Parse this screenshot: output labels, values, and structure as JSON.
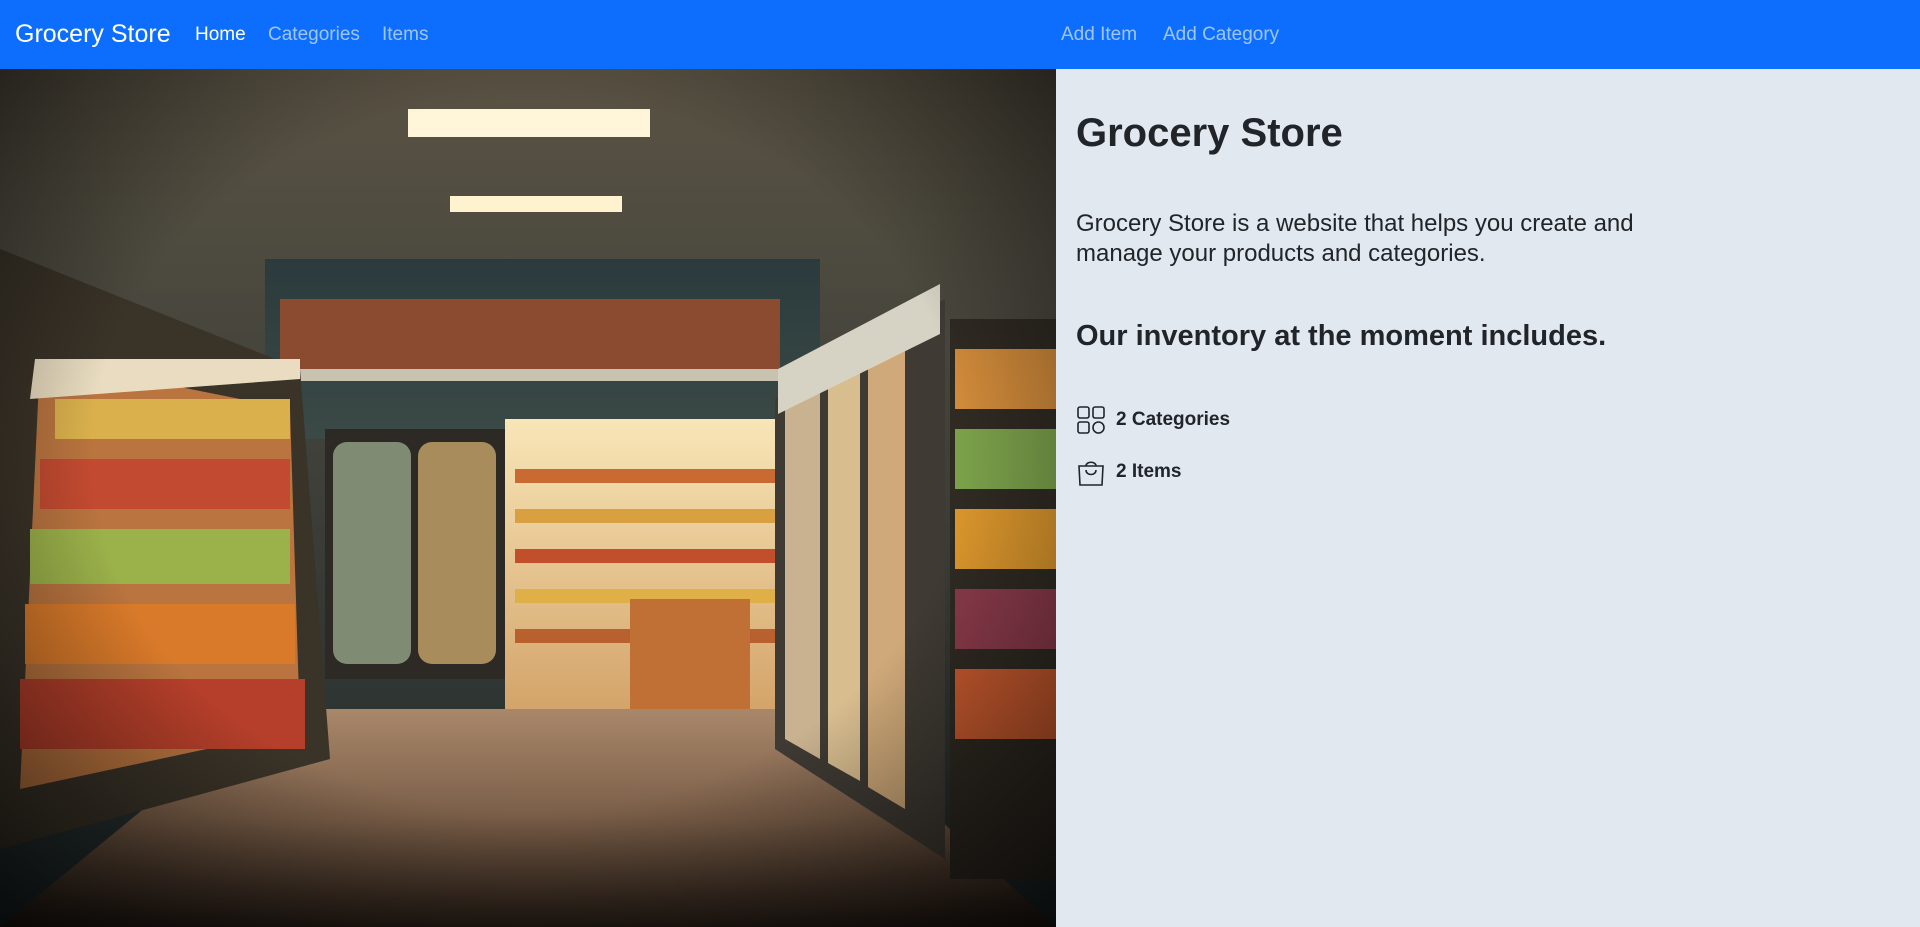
{
  "navbar": {
    "brand": "Grocery Store",
    "links": [
      "Home",
      "Categories",
      "Items"
    ],
    "right_links": [
      "Add Item",
      "Add Category"
    ],
    "active": "Home",
    "color": "#0d6efd"
  },
  "hero": {
    "icon": "grocery-store-aisle-image"
  },
  "main": {
    "title": "Grocery Store",
    "description": "Grocery Store is a website that helps you create and manage your products and categories.",
    "inventory_heading": "Our inventory at the moment includes.",
    "stats": [
      {
        "icon": "grid-icon",
        "label": "2 Categories"
      },
      {
        "icon": "shopping-bag-icon",
        "label": "2 Items"
      }
    ]
  },
  "colors": {
    "background": "#e2e8f0",
    "text": "#212529"
  }
}
